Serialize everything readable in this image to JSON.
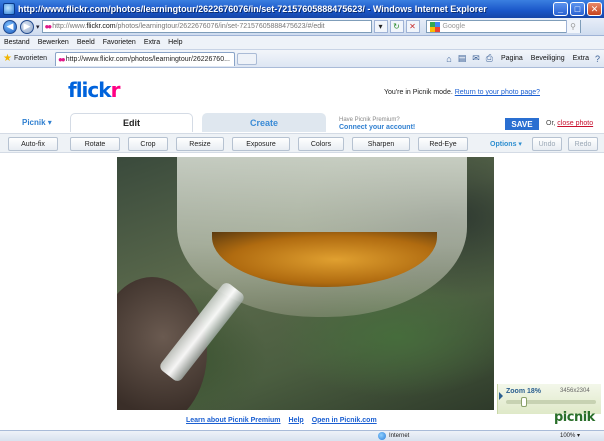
{
  "window": {
    "title": "http://www.flickr.com/photos/learningtour/2622676076/in/set-72157605888475623/ - Windows Internet Explorer"
  },
  "address": {
    "url_prefix": "http://www.",
    "url_domain": "flickr.com",
    "url_rest": "/photos/learningtour/2622676076/in/set-72157605888475623/#/edit",
    "search_placeholder": "Google"
  },
  "menu": {
    "items": [
      "Bestand",
      "Bewerken",
      "Beeld",
      "Favorieten",
      "Extra",
      "Help"
    ]
  },
  "favorites": {
    "label": "Favorieten",
    "tab_title": "http://www.flickr.com/photos/learningtour/26226760...",
    "commands": [
      "Pagina",
      "Beveiliging",
      "Extra"
    ]
  },
  "flickr": {
    "logo_fl": "flick",
    "logo_r": "r",
    "mode_text": "You're in Picnik mode.",
    "return_link": "Return to your photo page?"
  },
  "picnik": {
    "menu": "Picnik",
    "tab_edit": "Edit",
    "tab_create": "Create",
    "premium_line1": "Have Picnik Premium?",
    "premium_line2": "Connect your account!",
    "save": "SAVE",
    "or": "Or,",
    "close": "close photo"
  },
  "toolbar": {
    "tools": [
      "Auto-fix",
      "Rotate",
      "Crop",
      "Resize",
      "Exposure",
      "Colors",
      "Sharpen",
      "Red-Eye"
    ],
    "options": "Options",
    "undo": "Undo",
    "redo": "Redo"
  },
  "zoom": {
    "label": "Zoom 18%",
    "dimensions": "3456x2304",
    "level_fraction": 0.18
  },
  "bottom": {
    "learn": "Learn about Picnik Premium",
    "help": "Help",
    "open": "Open in Picnik.com",
    "logo": "picnik"
  },
  "status": {
    "zone": "Internet",
    "zoom": "100%"
  },
  "colors": {
    "flickr_blue": "#0063dc",
    "flickr_pink": "#ff0084",
    "save_blue": "#2a6fd1",
    "ie_title": "#1a56c8"
  }
}
